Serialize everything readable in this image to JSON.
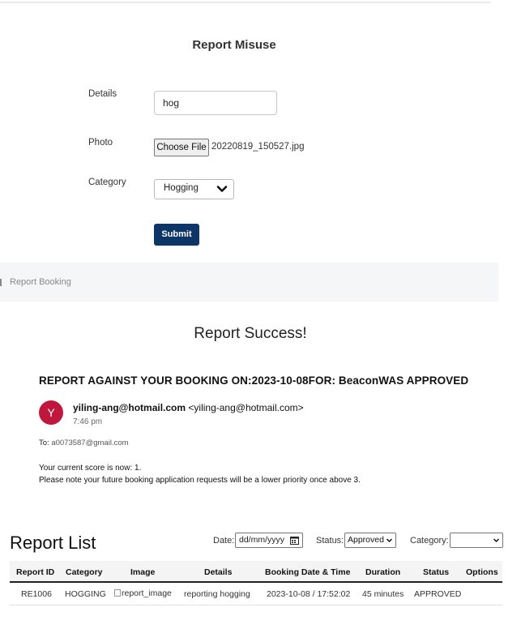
{
  "form": {
    "title": "Report Misuse",
    "details_label": "Details",
    "details_value": "hog",
    "photo_label": "Photo",
    "choose_file_label": "Choose File",
    "file_name": "20220819_150527.jpg",
    "category_label": "Category",
    "category_value": "Hogging",
    "submit_label": "Submit"
  },
  "breadcrumb": {
    "label": "Report Booking"
  },
  "success": {
    "title": "Report Success!",
    "subject": "REPORT AGAINST YOUR BOOKING ON:2023-10-08FOR: BeaconWAS APPROVED",
    "avatar_letter": "Y",
    "sender_email": "yiling-ang@hotmail.com",
    "sender_display": "<yiling-ang@hotmail.com>",
    "time": "7:46 pm",
    "to_label": "To:",
    "to_email": "a0073587@gmail.com",
    "body_line1": "Your current score is now: 1.",
    "body_line2": "Please note your future booking application requests will be a lower priority once above 3."
  },
  "report_list": {
    "title": "Report List",
    "date_label": "Date:",
    "date_placeholder": "dd/mm/yyyy",
    "status_label": "Status:",
    "status_value": "Approved",
    "category_label": "Category:",
    "category_value": "",
    "columns": [
      "Report ID",
      "Category",
      "Image",
      "Details",
      "Booking Date & Time",
      "Duration",
      "Status",
      "Options"
    ],
    "rows": [
      {
        "report_id": "RE1006",
        "category": "HOGGING",
        "image_alt": "report_image",
        "details": "reporting hogging",
        "booking_datetime": "2023-10-08 / 17:52:02",
        "duration": "45 minutes",
        "status": "APPROVED",
        "options": ""
      }
    ]
  },
  "icons": {
    "chevron": "chevron-down-icon",
    "calendar": "calendar-icon",
    "broken_image": "broken-image-icon"
  }
}
